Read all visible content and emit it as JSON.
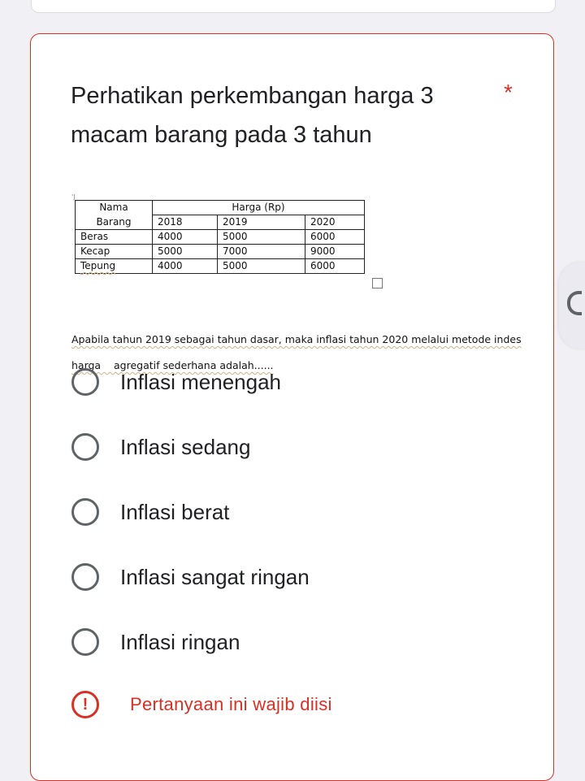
{
  "question": {
    "title": "Perhatikan  perkembangan harga 3 macam  barang pada 3 tahun",
    "required_mark": "*",
    "image": {
      "corner_mark": "'J",
      "table": {
        "header_row1": [
          "Nama",
          "Harga (Rp)"
        ],
        "header_row2": [
          "Barang",
          "2018",
          "2019",
          "2020"
        ],
        "rows": [
          [
            "Beras",
            "4000",
            "5000",
            "6000"
          ],
          [
            "Kecap",
            "5000",
            "7000",
            "9000"
          ],
          [
            "Tepung",
            "4000",
            "5000",
            "6000"
          ]
        ]
      },
      "text_line1": "Apabila tahun 2019 sebagai tahun dasar, maka inflasi tahun 2020 melalui metode indes",
      "text_line2": "harga    agregatif sederhana adalah......"
    }
  },
  "options": [
    {
      "label": "Inflasi menengah"
    },
    {
      "label": "Inflasi sedang"
    },
    {
      "label": "Inflasi berat"
    },
    {
      "label": "Inflasi sangat ringan"
    },
    {
      "label": "Inflasi ringan"
    }
  ],
  "error": {
    "icon": "!",
    "message": "Pertanyaan ini wajib diisi"
  },
  "colors": {
    "error_red": "#d93025",
    "page_bg": "#f1f0f5",
    "radio_gray": "#5f6368"
  }
}
